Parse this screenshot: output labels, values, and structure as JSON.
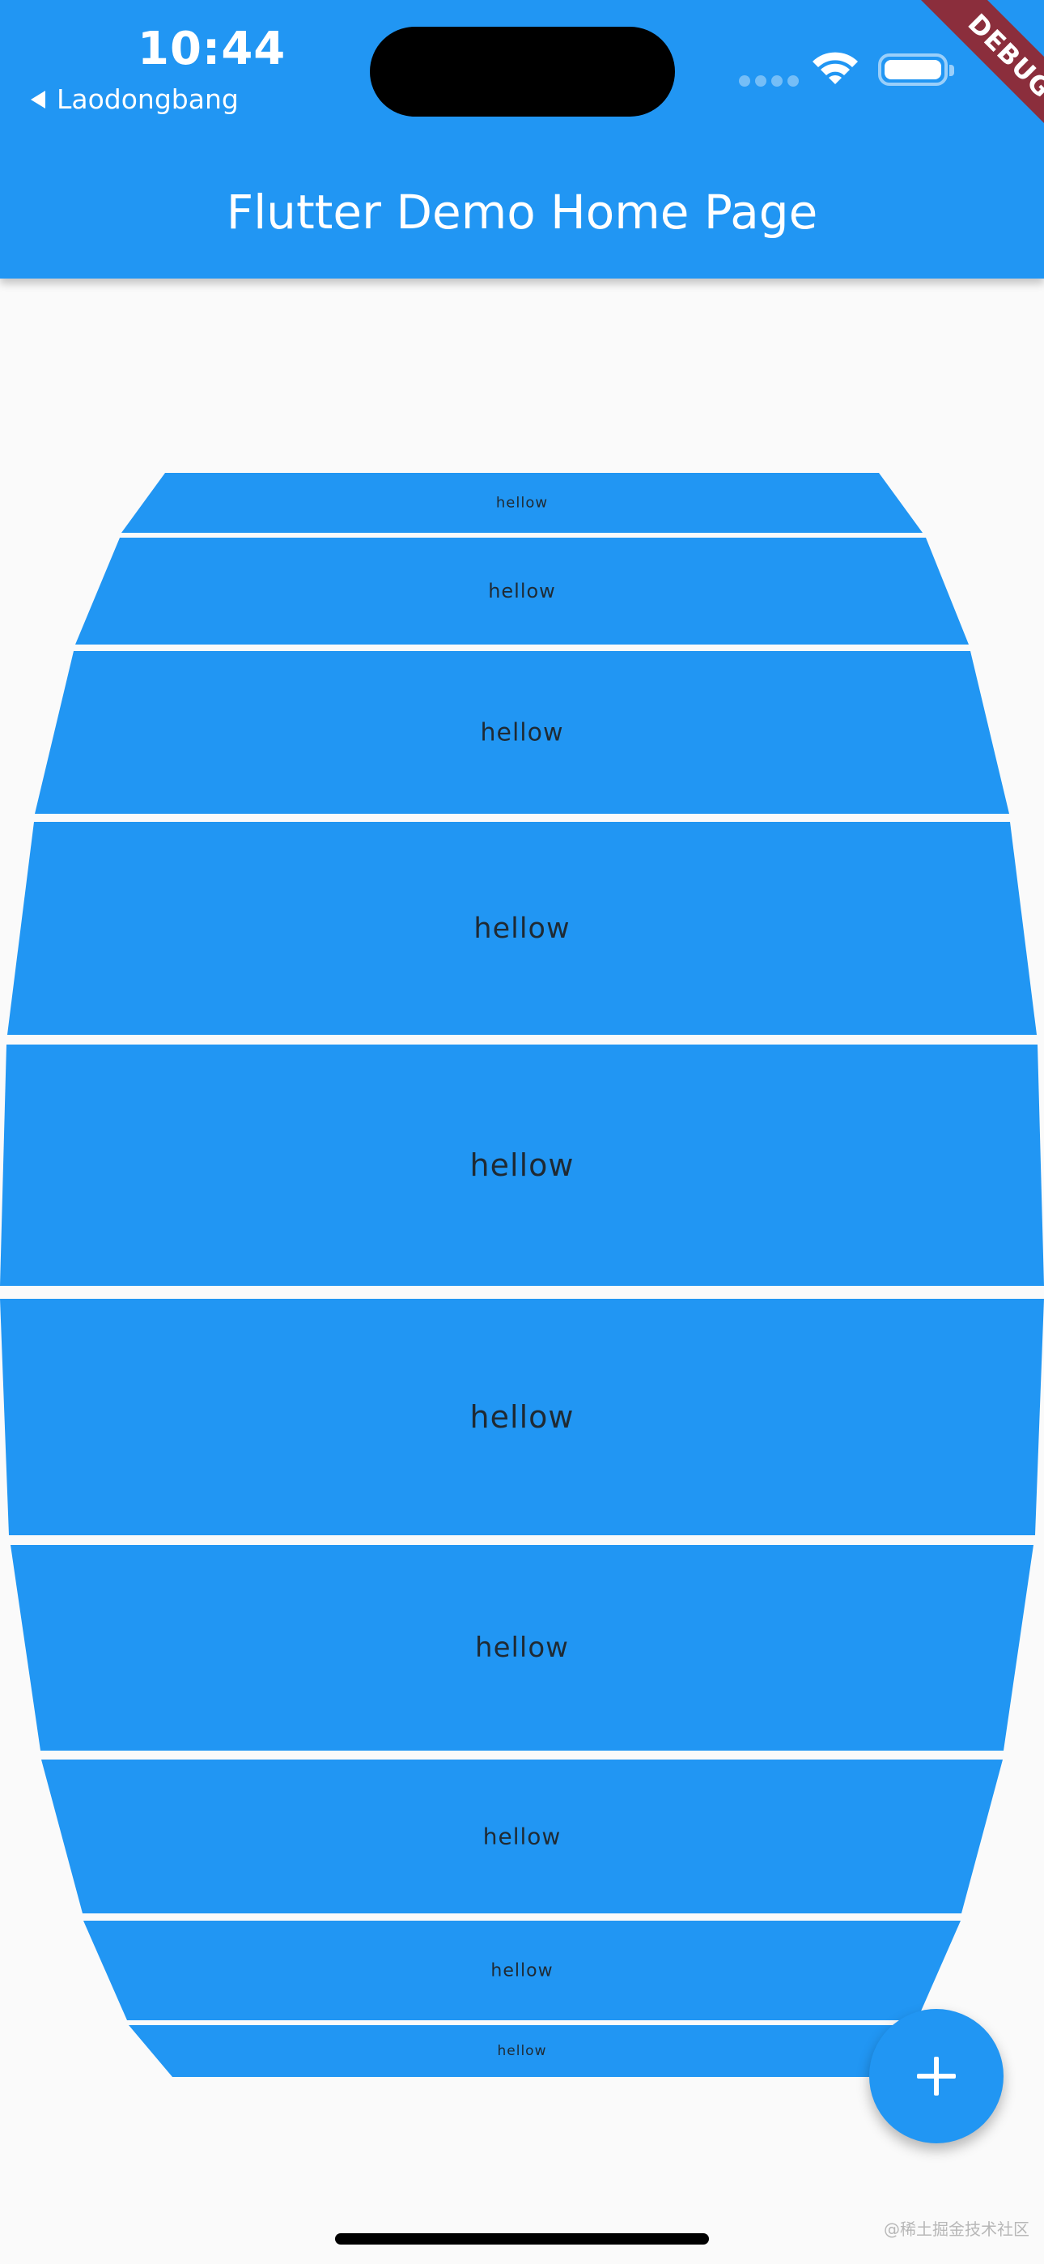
{
  "status_bar": {
    "time": "10:44",
    "back_app": "Laodongbang"
  },
  "app_bar": {
    "title": "Flutter Demo Home Page",
    "debug_banner": "DEBUG",
    "color": "#2196f3"
  },
  "list": {
    "item_color": "#2196f3",
    "items": [
      {
        "label": "hellow"
      },
      {
        "label": "hellow"
      },
      {
        "label": "hellow"
      },
      {
        "label": "hellow"
      },
      {
        "label": "hellow"
      },
      {
        "label": "hellow"
      },
      {
        "label": "hellow"
      },
      {
        "label": "hellow"
      },
      {
        "label": "hellow"
      },
      {
        "label": "hellow"
      }
    ]
  },
  "fab": {
    "icon": "add-icon"
  },
  "watermark": "@稀土掘金技术社区"
}
